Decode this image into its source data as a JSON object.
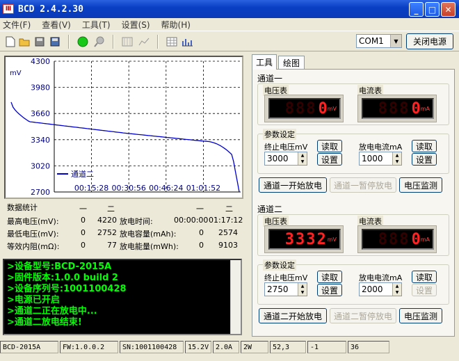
{
  "window": {
    "title": "BCD 2.4.2.30",
    "min": "_",
    "max": "□",
    "close": "✕"
  },
  "menu": [
    "文件(F)",
    "查看(V)",
    "工具(T)",
    "设置(S)",
    "帮助(H)"
  ],
  "toolbar": {
    "com_port": "COM1",
    "power_button": "关闭电源"
  },
  "chart_data": {
    "type": "line",
    "series": [
      {
        "name": "通道二",
        "x": [
          "00:00:00",
          "00:15:28",
          "00:30:56",
          "00:46:24",
          "01:01:52",
          "01:17:12"
        ],
        "values": [
          3800,
          3480,
          3410,
          3380,
          3330,
          2700
        ]
      }
    ],
    "ylabel": "mV",
    "yticks": [
      4300,
      3980,
      3660,
      3340,
      3020,
      2700
    ],
    "xticks": [
      "00:15:28",
      "00:30:56",
      "00:46:24",
      "01:01:52"
    ],
    "ylim": [
      2700,
      4300
    ],
    "grid": true,
    "legend_position": "bottom-left",
    "line_color": "#0000cc"
  },
  "stats": {
    "title": "数据统计",
    "col_header_1": "一",
    "col_header_2": "二",
    "rows": [
      {
        "label": "最高电压(mV):",
        "v1": "0",
        "v2": "4220",
        "label2": "放电时间:",
        "v3": "00:00:00",
        "v4": "01:17:12"
      },
      {
        "label": "最低电压(mV):",
        "v1": "0",
        "v2": "2752",
        "label2": "放电容量(mAh):",
        "v3": "0",
        "v4": "2574"
      },
      {
        "label": "等效内阻(mΩ):",
        "v1": "0",
        "v2": "77",
        "label2": "放电能量(mWh):",
        "v3": "0",
        "v4": "9103"
      }
    ]
  },
  "console": {
    "lines": [
      ">设备型号:BCD-2015A",
      ">固件版本:1.0.0 build 2",
      ">设备序列号:1001100428",
      ">电源已开启",
      ">通道二正在放电中...",
      ">通道二放电结束!"
    ]
  },
  "tabs": [
    "工具",
    "绘图"
  ],
  "ch1": {
    "title": "通道一",
    "volt_label": "电压表",
    "curr_label": "电流表",
    "volt_value": "0",
    "volt_unit": "mV",
    "curr_value": "0",
    "curr_unit": "mA",
    "param_label": "参数设定",
    "stopv_label": "终止电压mV",
    "stopv_value": "3000",
    "curr_set_label": "放电电流mA",
    "curr_set_value": "1000",
    "read1": "读取",
    "set1": "设置",
    "read2": "读取",
    "set2": "设置",
    "start": "通道一开始放电",
    "pause": "通道一暂停放电",
    "monitor": "电压监测"
  },
  "ch2": {
    "title": "通道二",
    "volt_label": "电压表",
    "curr_label": "电流表",
    "volt_value": "3332",
    "volt_unit": "mV",
    "curr_value": "0",
    "curr_unit": "mA",
    "param_label": "参数设定",
    "stopv_label": "终止电压mV",
    "stopv_value": "2750",
    "curr_set_label": "放电电流mA",
    "curr_set_value": "2000",
    "read1": "读取",
    "set1": "设置",
    "read2": "读取",
    "set2": "设置",
    "start": "通道二开始放电",
    "pause": "通道二暂停放电",
    "monitor": "电压监测"
  },
  "status": [
    "BCD-2015A",
    "FW:1.0.0.2",
    "SN:1001100428",
    "15.2V",
    "2.0A",
    "2W",
    "52,3",
    "-1",
    "36"
  ]
}
